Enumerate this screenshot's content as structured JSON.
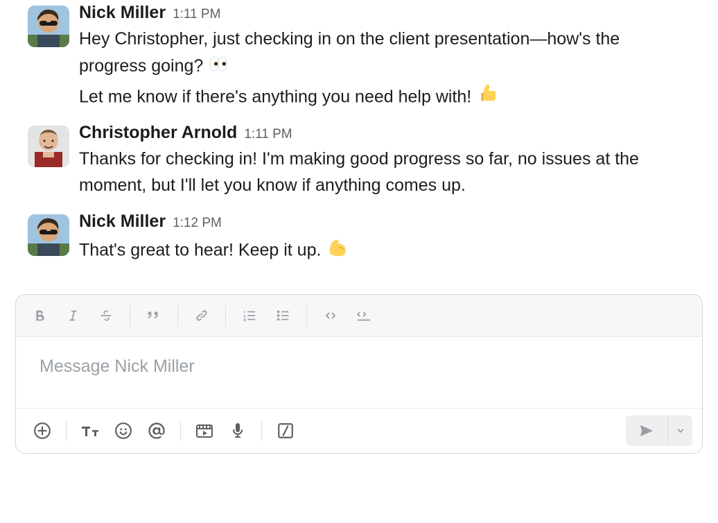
{
  "messages": [
    {
      "sender": "Nick Miller",
      "time": "1:11 PM",
      "avatar_key": "nick",
      "lines": [
        {
          "text": "Hey Christopher, just checking in on the client presentation—how's the progress going? ",
          "trailing_emoji": "eyes"
        },
        {
          "text": "Let me know if there's anything you need help with! ",
          "trailing_emoji": "thumbs-up"
        }
      ]
    },
    {
      "sender": "Christopher Arnold",
      "time": "1:11 PM",
      "avatar_key": "christopher",
      "lines": [
        {
          "text": "Thanks for checking in! I'm making good progress so far, no issues at the moment, but I'll let you know if anything comes up.",
          "trailing_emoji": null
        }
      ]
    },
    {
      "sender": "Nick Miller",
      "time": "1:12 PM",
      "avatar_key": "nick",
      "lines": [
        {
          "text": "That's great to hear! Keep it up. ",
          "trailing_emoji": "flex-arm"
        }
      ]
    }
  ],
  "composer": {
    "placeholder": "Message Nick Miller",
    "value": "",
    "top_toolbar": [
      {
        "name": "bold-button",
        "icon": "bold"
      },
      {
        "name": "italic-button",
        "icon": "italic"
      },
      {
        "name": "strike-button",
        "icon": "strike"
      },
      {
        "sep": true
      },
      {
        "name": "quote-button",
        "icon": "quote"
      },
      {
        "sep": true
      },
      {
        "name": "link-button",
        "icon": "link"
      },
      {
        "sep": true
      },
      {
        "name": "ordered-list-button",
        "icon": "ol"
      },
      {
        "name": "bullet-list-button",
        "icon": "ul"
      },
      {
        "sep": true
      },
      {
        "name": "code-button",
        "icon": "code"
      },
      {
        "name": "code-block-button",
        "icon": "codeblock"
      }
    ],
    "bottom_toolbar": [
      {
        "name": "attach-button",
        "icon": "plus"
      },
      {
        "sep": true
      },
      {
        "name": "formatting-toggle-button",
        "icon": "tt"
      },
      {
        "name": "emoji-button",
        "icon": "smile"
      },
      {
        "name": "mention-button",
        "icon": "at"
      },
      {
        "sep": true
      },
      {
        "name": "video-clip-button",
        "icon": "video"
      },
      {
        "name": "audio-clip-button",
        "icon": "mic"
      },
      {
        "sep": true
      },
      {
        "name": "shortcuts-button",
        "icon": "slash-square"
      }
    ]
  }
}
